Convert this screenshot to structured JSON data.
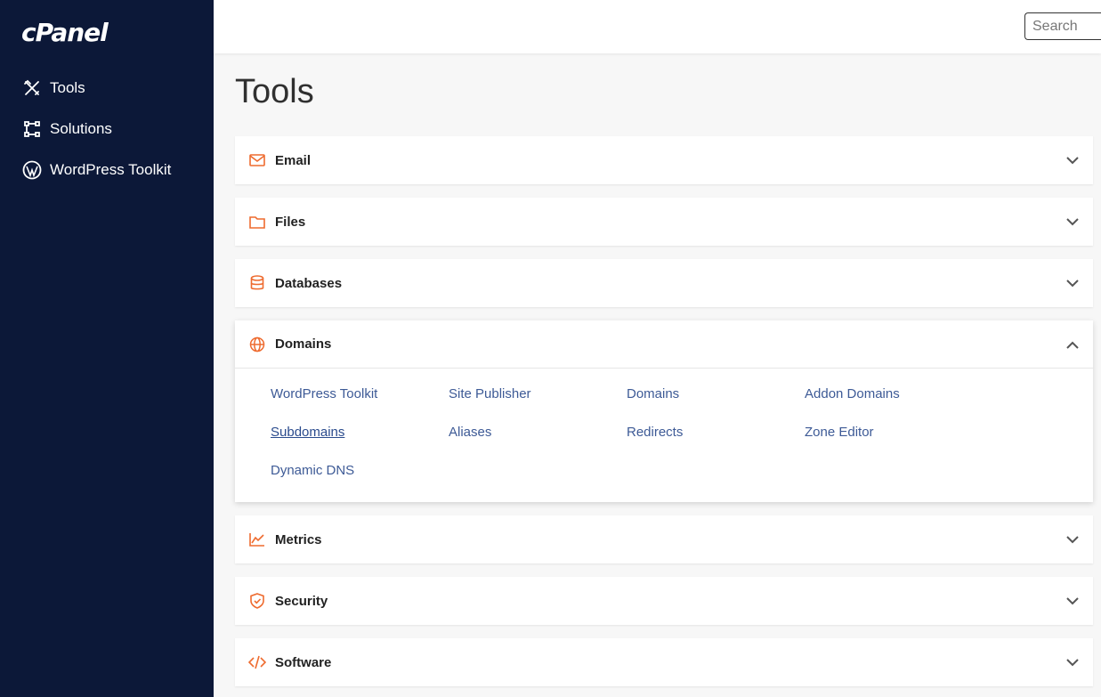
{
  "sidebar": {
    "logo": "cPanel",
    "items": [
      {
        "label": "Tools",
        "icon": "tools-icon"
      },
      {
        "label": "Solutions",
        "icon": "solutions-icon"
      },
      {
        "label": "WordPress Toolkit",
        "icon": "wordpress-icon"
      }
    ]
  },
  "search": {
    "placeholder": "Search",
    "value": ""
  },
  "page": {
    "title": "Tools"
  },
  "colors": {
    "sidebar_bg": "#0c1838",
    "accent": "#ee6b2f",
    "link": "#3d5a96"
  },
  "sections": [
    {
      "title": "Email",
      "icon": "mail-icon",
      "expanded": false
    },
    {
      "title": "Files",
      "icon": "folder-icon",
      "expanded": false
    },
    {
      "title": "Databases",
      "icon": "database-icon",
      "expanded": false
    },
    {
      "title": "Domains",
      "icon": "globe-icon",
      "expanded": true,
      "tools": [
        "WordPress Toolkit",
        "Site Publisher",
        "Domains",
        "Addon Domains",
        "Subdomains",
        "Aliases",
        "Redirects",
        "Zone Editor",
        "Dynamic DNS"
      ]
    },
    {
      "title": "Metrics",
      "icon": "chart-icon",
      "expanded": false
    },
    {
      "title": "Security",
      "icon": "shield-icon",
      "expanded": false
    },
    {
      "title": "Software",
      "icon": "code-icon",
      "expanded": false
    }
  ]
}
